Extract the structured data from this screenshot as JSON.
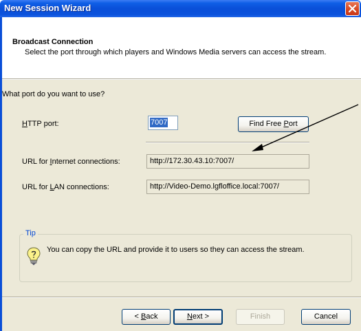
{
  "window": {
    "title": "New Session Wizard"
  },
  "header": {
    "title": "Broadcast Connection",
    "description": "Select the port through which players and Windows Media servers can access the stream."
  },
  "question": "What port do you want to use?",
  "http_port": {
    "label_prefix": "",
    "label_accel": "H",
    "label_rest": "TTP port:",
    "value": "7007"
  },
  "find_free_port": {
    "label_prefix": "Find Free ",
    "label_accel": "P",
    "label_rest": "ort"
  },
  "internet_url": {
    "label_prefix": "URL for ",
    "label_accel": "I",
    "label_rest": "nternet connections:",
    "value": "http://172.30.43.10:7007/"
  },
  "lan_url": {
    "label_prefix": "URL for ",
    "label_accel": "L",
    "label_rest": "AN connections:",
    "value": "http://Video-Demo.lgfloffice.local:7007/"
  },
  "tip": {
    "legend": "Tip",
    "text": "You can copy the URL and provide it to users so they can access the stream.",
    "icon": "lightbulb-icon"
  },
  "buttons": {
    "back": {
      "prefix": "< ",
      "accel": "B",
      "rest": "ack"
    },
    "next": {
      "accel": "N",
      "rest": "ext >"
    },
    "finish": "Finish",
    "cancel": "Cancel"
  },
  "colors": {
    "titlebar": "#0a4fd8",
    "dialog_bg": "#ece9d8",
    "tip_legend": "#0046d5",
    "close_button": "#d6451e"
  }
}
